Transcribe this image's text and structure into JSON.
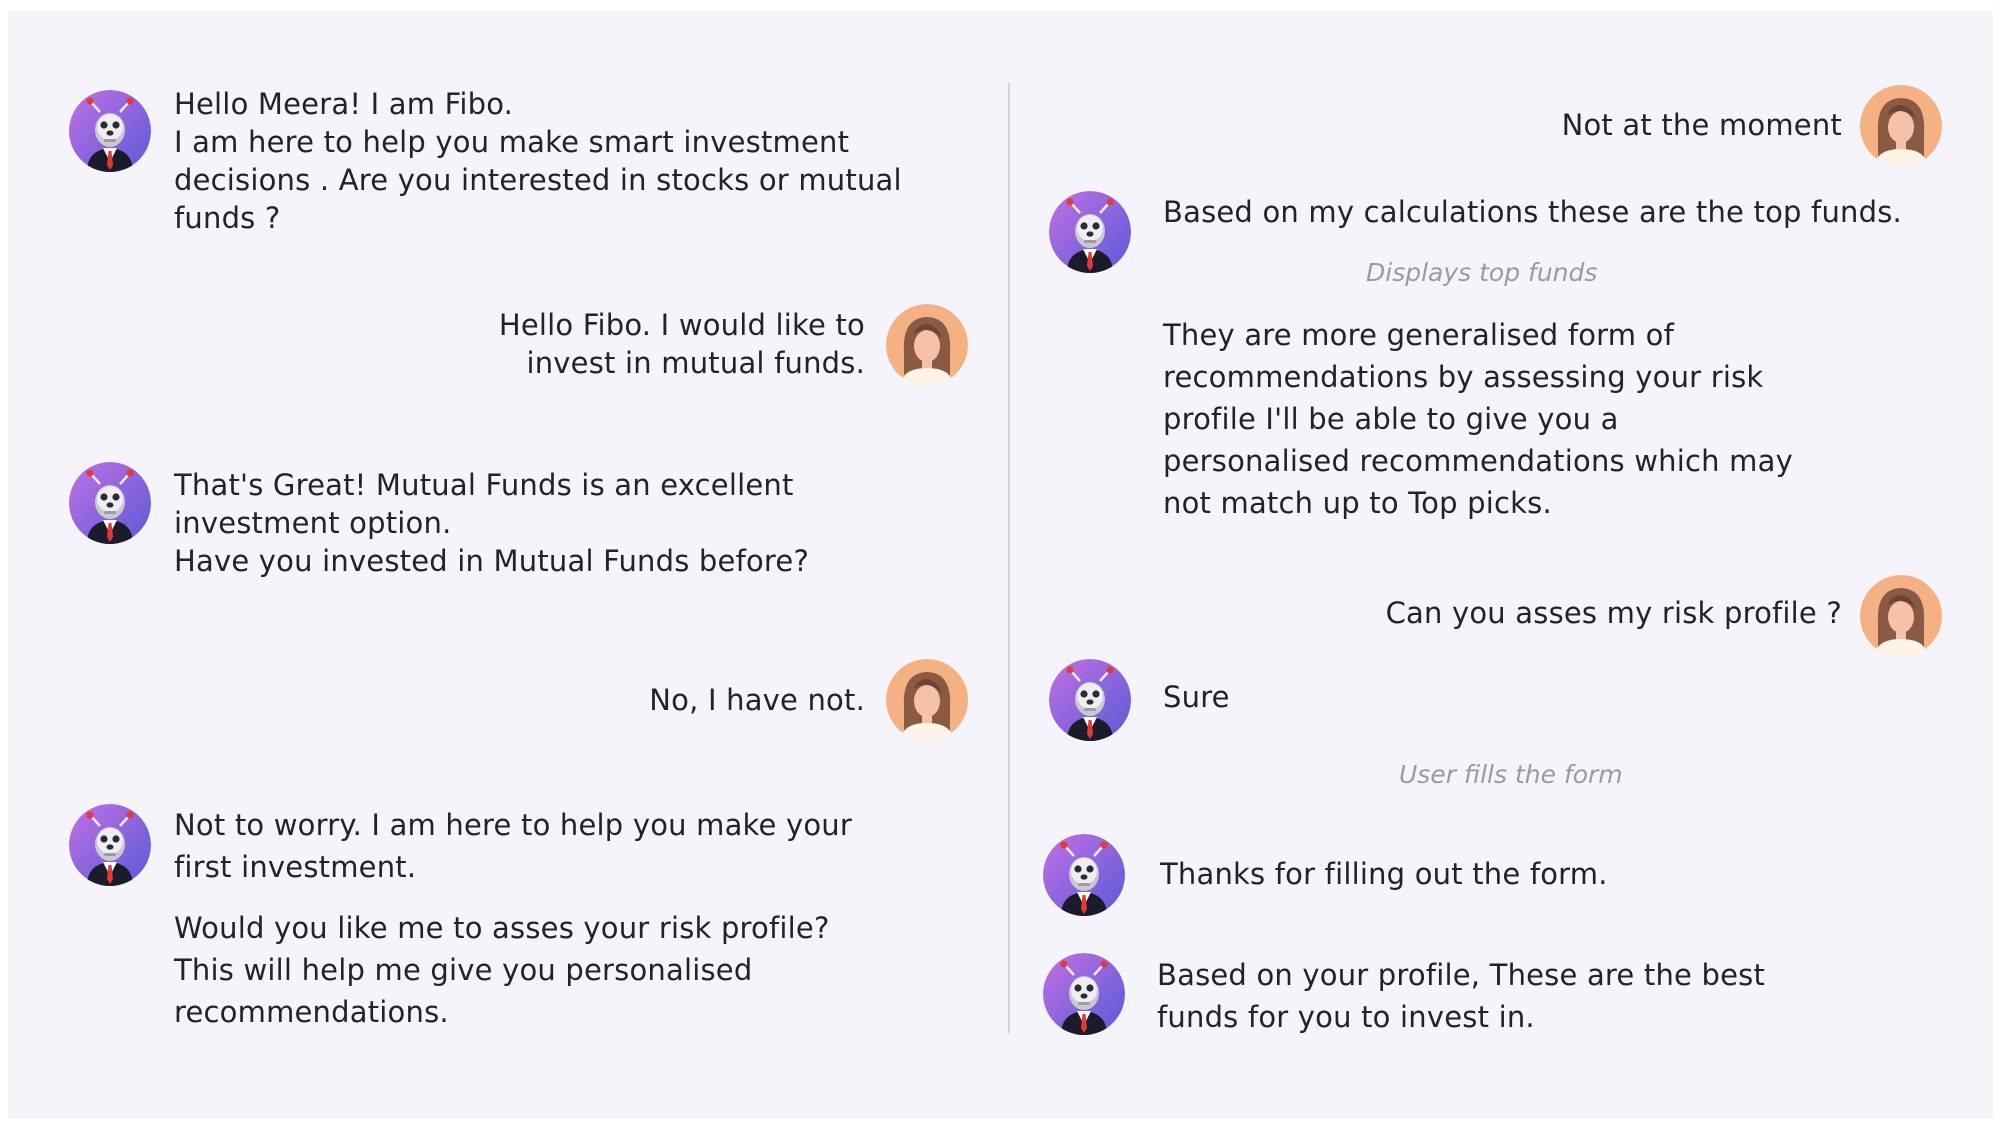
{
  "conversation": {
    "left": {
      "m1": [
        "Hello Meera! I am Fibo.",
        "I am here to help you make smart investment",
        "decisions . Are you interested in stocks or mutual",
        "funds ?"
      ],
      "m2": [
        "Hello Fibo. I would like to",
        "invest in mutual funds."
      ],
      "m3": [
        "That's Great! Mutual Funds is an excellent",
        "investment option.",
        "Have you invested in Mutual Funds before?"
      ],
      "m4": "No, I have not.",
      "m5a": [
        "Not to worry. I am here to help you make your",
        "first investment."
      ],
      "m5b": [
        "Would you like me to asses your risk profile?",
        "This will help me give you personalised",
        "recommendations."
      ]
    },
    "right": {
      "m6": "Not at the moment",
      "m7": "Based on my calculations these are the top funds.",
      "note1": "Displays top funds",
      "m8": [
        "They are more generalised form of",
        "recommendations by assessing your risk",
        "profile I'll be able to give you a",
        "personalised recommendations which may",
        "not match up to Top picks."
      ],
      "m9": "Can you asses my risk profile ?",
      "m10": "Sure",
      "note2": "User fills the form",
      "m11": "Thanks for filling out the form.",
      "m12": [
        "Based on your profile, These are the best",
        "funds for you to invest in."
      ]
    }
  },
  "avatars": {
    "bot_icon": "robot-icon",
    "user_icon": "woman-icon"
  },
  "colors": {
    "panel_background": "#f5f4fa",
    "bot_avatar_gradient": [
      "#b66ee0",
      "#5b5bd6"
    ],
    "user_avatar_background": "#f4b183",
    "note_text": "#9a9aa4"
  }
}
